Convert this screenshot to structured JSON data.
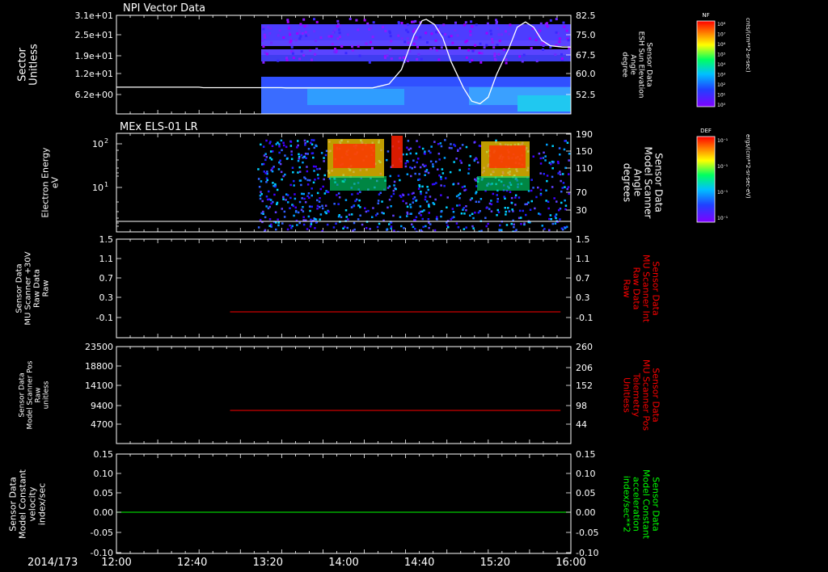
{
  "footer": {
    "date": "2014/173"
  },
  "time_axis": {
    "ticks": [
      "12:00",
      "12:40",
      "13:20",
      "14:00",
      "14:40",
      "15:20",
      "16:00"
    ]
  },
  "colorbars": [
    {
      "tag": "NF",
      "unit": "cnts/(cm**2-sr-sec)",
      "ticks": [
        "10⁸",
        "10⁷",
        "10⁶",
        "10⁵",
        "10⁴",
        "10³",
        "10²",
        "10¹",
        "10⁰"
      ]
    },
    {
      "tag": "DEF",
      "unit": "ergs/(cm**2-sr-sec-eV)",
      "ticks": [
        "10⁻¹",
        "10⁻¹",
        "10⁻¹",
        "10⁻¹"
      ]
    }
  ],
  "chart_data": [
    {
      "type": "heatmap",
      "title": "NPI Vector Data",
      "ylabel": [
        "Sector",
        "Unitless"
      ],
      "yticks": [
        "3.1e+01",
        "2.5e+01",
        "1.9e+01",
        "1.2e+01",
        "6.2e+00"
      ],
      "y2label": [
        "Sensor Data",
        "ESH Sun Elevation",
        "Angle",
        "degree"
      ],
      "y2ticks": [
        "82.5",
        "75.0",
        "67.5",
        "60.0",
        "52.5"
      ],
      "y2lim": [
        47,
        83
      ],
      "line_series": {
        "name": "ESH Sun Elevation Angle",
        "color": "#ffffff",
        "points": [
          [
            0,
            55.3
          ],
          [
            20,
            55.3
          ],
          [
            21,
            55.1
          ],
          [
            40,
            55.1
          ],
          [
            41,
            55.0
          ],
          [
            62,
            55.0
          ],
          [
            66,
            56.5
          ],
          [
            69,
            62
          ],
          [
            72,
            75
          ],
          [
            74,
            80.5
          ],
          [
            75,
            81
          ],
          [
            77,
            79
          ],
          [
            79,
            74
          ],
          [
            81,
            65
          ],
          [
            84,
            55
          ],
          [
            86,
            50
          ],
          [
            88,
            49
          ],
          [
            90,
            51.5
          ],
          [
            92,
            60
          ],
          [
            95,
            70
          ],
          [
            97,
            78
          ],
          [
            99,
            80
          ],
          [
            101,
            78
          ],
          [
            103,
            73
          ],
          [
            105,
            71
          ],
          [
            108,
            70.5
          ],
          [
            110,
            70.5
          ]
        ]
      }
    },
    {
      "type": "heatmap",
      "title": "MEx ELS-01 LR",
      "ylabel": [
        "Electron Energy",
        "eV"
      ],
      "ytick_bases": [
        "10",
        "10"
      ],
      "ytick_exps": [
        "2",
        "1"
      ],
      "y2label": [
        "Sensor Data",
        "Model Scanner",
        "Angle",
        "degrees"
      ],
      "y2ticks": [
        "190",
        "150",
        "110",
        "70",
        "30"
      ],
      "y2lim": [
        0,
        190
      ],
      "line_series": {
        "name": "Model Scanner Angle",
        "color": "#ffffff",
        "points": [
          [
            0,
            5.5
          ],
          [
            110,
            5.5
          ]
        ]
      }
    },
    {
      "type": "line",
      "ylabel": [
        "Sensor Data",
        "MU Scanner +30V",
        "Raw Data",
        "Raw"
      ],
      "yticks": [
        "1.5",
        "1.1",
        "0.7",
        "0.3",
        "-0.1"
      ],
      "ylim": [
        -0.5,
        1.5
      ],
      "y2label": [
        "Sensor Data",
        "MU Scanner Int",
        "Raw Data",
        "Raw"
      ],
      "y2ticks": [
        "1.5",
        "1.1",
        "0.7",
        "0.3",
        "-0.1"
      ],
      "series": [
        {
          "name": "MU Scanner Int Raw Data",
          "color": "#ff0000",
          "points": [
            [
              30,
              0
            ],
            [
              110,
              0
            ]
          ]
        }
      ]
    },
    {
      "type": "line",
      "ylabel": [
        "Sensor Data",
        "Model Scanner Pos",
        "Raw",
        "unitless"
      ],
      "yticks": [
        "23500",
        "18800",
        "14100",
        "9400",
        "4700"
      ],
      "ylim": [
        0,
        23500
      ],
      "y2label": [
        "Sensor Data",
        "MU Scanner Pos",
        "Telemetry",
        "Unitless"
      ],
      "y2ticks": [
        "260",
        "206",
        "152",
        "98",
        "44"
      ],
      "series": [
        {
          "name": "MU Scanner Pos Telemetry",
          "color": "#ff0000",
          "points": [
            [
              30,
              7800
            ],
            [
              110,
              7800
            ]
          ]
        }
      ]
    },
    {
      "type": "line",
      "ylabel": [
        "Sensor Data",
        "Model Constant",
        "velocity",
        "index/sec"
      ],
      "yticks": [
        "0.15",
        "0.10",
        "0.05",
        "0.00",
        "-0.05",
        "-0.10"
      ],
      "ylim": [
        -0.1,
        0.15
      ],
      "y2label": [
        "Sensor Data",
        "Model Constant",
        "acceleration",
        "index/sec**2"
      ],
      "y2ticks": [
        "0.15",
        "0.10",
        "0.05",
        "0.00",
        "-0.05",
        "-0.10"
      ],
      "series": [
        {
          "name": "Model Constant velocity",
          "color": "#00ff00",
          "points": [
            [
              0,
              0
            ],
            [
              110,
              0
            ]
          ]
        }
      ]
    }
  ],
  "colors": {
    "axis": "#ffffff",
    "red": "#ff0000",
    "green": "#00ff00",
    "bg": "#000000"
  }
}
